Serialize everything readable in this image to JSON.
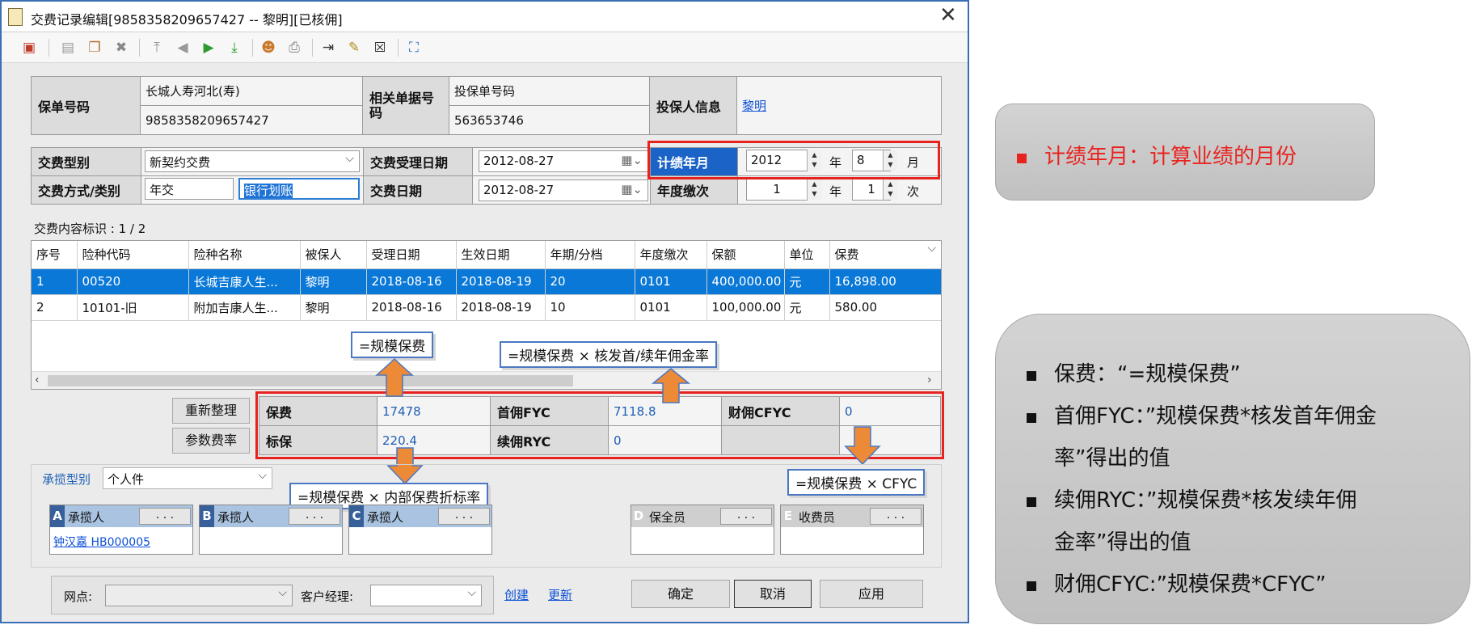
{
  "window": {
    "title": "交费记录编辑[9858358209657427 -- 黎明][已核佣]",
    "close_symbol": "✕"
  },
  "toolbar": {
    "icons": [
      "delete-record-icon",
      "save-icon",
      "copy-icon",
      "cancel-icon",
      "first-icon",
      "prev-icon",
      "next-icon",
      "last-icon",
      "user-icon",
      "print-icon",
      "import-icon",
      "edit-icon",
      "export-icon",
      "fullscreen-icon"
    ]
  },
  "policy": {
    "policy_no_label": "保单号码",
    "company": "长城人寿河北(寿)",
    "policy_no": "9858358209657427",
    "related_label": "相关单据号码",
    "app_no_label": "投保单号码",
    "app_no": "563653746",
    "applicant_label": "投保人信息",
    "applicant": "黎明"
  },
  "payment": {
    "type_label": "交费型别",
    "type_value": "新契约交费",
    "accept_date_label": "交费受理日期",
    "accept_date": "2012-08-27",
    "perf_label": "计绩年月",
    "perf_year": "2012",
    "year_unit": "年",
    "perf_month": "8",
    "month_unit": "月",
    "method_label": "交费方式/类别",
    "method_value": "年交",
    "category_value": "银行划账",
    "pay_date_label": "交费日期",
    "pay_date": "2012-08-27",
    "annual_label": "年度缴次",
    "annual_year": "1",
    "annual_count": "1",
    "count_unit": "次"
  },
  "detail": {
    "caption": "交费内容标识 : 1 / 2",
    "columns": [
      "序号",
      "险种代码",
      "险种名称",
      "被保人",
      "受理日期",
      "生效日期",
      "年期/分档",
      "年度缴次",
      "保额",
      "单位",
      "保费"
    ],
    "rows": [
      [
        "1",
        "00520",
        "长城吉康人生...",
        "黎明",
        "2018-08-16",
        "2018-08-19",
        "20",
        "0101",
        "400,000.00",
        "元",
        "16,898.00"
      ],
      [
        "2",
        "10101-旧",
        "附加吉康人生...",
        "黎明",
        "2018-08-16",
        "2018-08-19",
        "10",
        "0101",
        "100,000.00",
        "元",
        "580.00"
      ]
    ]
  },
  "summary": {
    "reorg_button": "重新整理",
    "param_button": "参数费率",
    "premium_label": "保费",
    "premium_value": "17478",
    "fyc_label": "首佣FYC",
    "fyc_value": "7118.8",
    "cfyc_label": "财佣CFYC",
    "cfyc_value": "0",
    "std_label": "标保",
    "std_value": "220.4",
    "ryc_label": "续佣RYC",
    "ryc_value": "0"
  },
  "callouts": {
    "premium": "=规模保费",
    "fyc": "=规模保费 × 核发首/续年佣金率",
    "std": "=规模保费 × 内部保费折标率",
    "cfyc": "=规模保费 × CFYC"
  },
  "agents": {
    "type_label": "承揽型别",
    "type_value": "个人件",
    "a_letter": "A",
    "a_title": "承揽人",
    "a_value": "钟汉嘉 HB000005",
    "b_letter": "B",
    "b_title": "承揽人",
    "c_letter": "C",
    "c_title": "承揽人",
    "d_letter": "D",
    "d_title": "保全员",
    "e_letter": "E",
    "e_title": "收费员",
    "dots": ". . ."
  },
  "footer": {
    "outlet_label": "网点:",
    "manager_label": "客户经理:",
    "create_link": "创建",
    "update_link": "更新",
    "ok_button": "确定",
    "cancel_button": "取消",
    "apply_button": "应用"
  },
  "side": {
    "top_note": "计绩年月：计算业绩的月份",
    "notes": [
      "保费：“=规模保费”",
      "首佣FYC：”规模保费*核发首年佣金",
      "率”得出的值",
      "续佣RYC：”规模保费*核发续年佣",
      "金率”得出的值",
      "财佣CFYC:”规模保费*CFYC”"
    ]
  },
  "colors": {
    "accent_red": "#e8231f",
    "selection_blue": "#0a78d7",
    "callout_arrow": "#ed8a37",
    "link": "#0b4fd6"
  }
}
